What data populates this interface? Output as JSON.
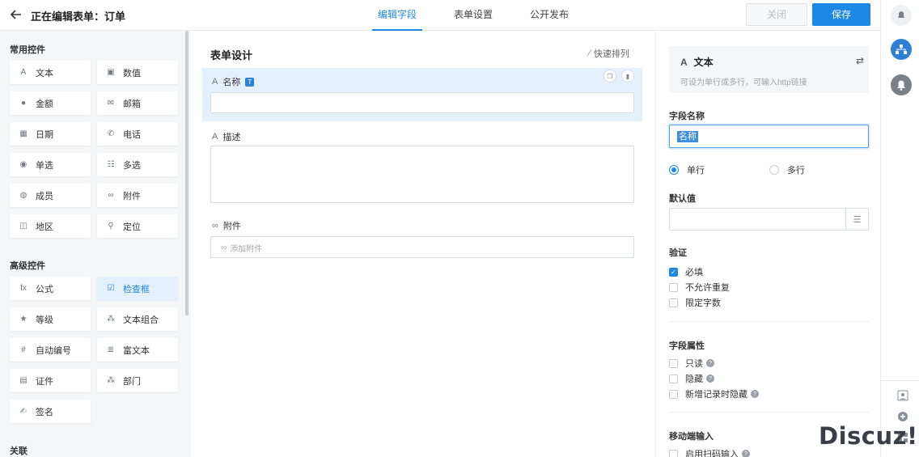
{
  "header": {
    "title_prefix": "正在编辑表单：",
    "title_name": "订单",
    "tabs": [
      {
        "label": "编辑字段",
        "active": true
      },
      {
        "label": "表单设置",
        "active": false
      },
      {
        "label": "公开发布",
        "active": false
      }
    ],
    "close_label": "关闭",
    "save_label": "保存"
  },
  "palette": {
    "groups": [
      {
        "title": "常用控件",
        "items": [
          {
            "label": "文本",
            "icon": "text-a-icon",
            "glyph": "A"
          },
          {
            "label": "数值",
            "icon": "number-icon",
            "glyph": "▣"
          },
          {
            "label": "金额",
            "icon": "money-icon",
            "glyph": "●"
          },
          {
            "label": "邮箱",
            "icon": "mail-icon",
            "glyph": "✉"
          },
          {
            "label": "日期",
            "icon": "calendar-icon",
            "glyph": "▦"
          },
          {
            "label": "电话",
            "icon": "phone-icon",
            "glyph": "✆"
          },
          {
            "label": "单选",
            "icon": "radio-icon",
            "glyph": "◉"
          },
          {
            "label": "多选",
            "icon": "checklist-icon",
            "glyph": "☷"
          },
          {
            "label": "成员",
            "icon": "member-icon",
            "glyph": "◍"
          },
          {
            "label": "附件",
            "icon": "paperclip-icon",
            "glyph": "∞"
          },
          {
            "label": "地区",
            "icon": "map-icon",
            "glyph": "◫"
          },
          {
            "label": "定位",
            "icon": "location-pin-icon",
            "glyph": "⚲"
          }
        ]
      },
      {
        "title": "高级控件",
        "items": [
          {
            "label": "公式",
            "icon": "formula-icon",
            "glyph": "fx"
          },
          {
            "label": "检查框",
            "icon": "checkbox-icon",
            "glyph": "☑",
            "active": true
          },
          {
            "label": "等级",
            "icon": "star-icon",
            "glyph": "★"
          },
          {
            "label": "文本组合",
            "icon": "text-combo-icon",
            "glyph": "⁂"
          },
          {
            "label": "自动编号",
            "icon": "hash-icon",
            "glyph": "#"
          },
          {
            "label": "富文本",
            "icon": "rich-text-icon",
            "glyph": "≣"
          },
          {
            "label": "证件",
            "icon": "id-card-icon",
            "glyph": "▤"
          },
          {
            "label": "部门",
            "icon": "department-icon",
            "glyph": "⁂"
          },
          {
            "label": "签名",
            "icon": "signature-icon",
            "glyph": "✍"
          }
        ]
      },
      {
        "title": "关联",
        "items": []
      }
    ]
  },
  "canvas": {
    "title": "表单设计",
    "quick_sort": "快速排列",
    "fields": [
      {
        "label": "名称",
        "type_badge": "T",
        "selected": true
      },
      {
        "label": "描述"
      },
      {
        "label": "附件",
        "placeholder": "添加附件"
      }
    ]
  },
  "props": {
    "type_title": "文本",
    "type_desc": "可设为单行或多行，可输入http链接",
    "field_name_label": "字段名称",
    "field_name_value": "名称",
    "line_options": [
      {
        "label": "单行",
        "checked": true
      },
      {
        "label": "多行",
        "checked": false
      }
    ],
    "default_label": "默认值",
    "validation_label": "验证",
    "validation_options": [
      {
        "label": "必填",
        "checked": true
      },
      {
        "label": "不允许重复",
        "checked": false
      },
      {
        "label": "限定字数",
        "checked": false
      }
    ],
    "attributes_label": "字段属性",
    "attributes_options": [
      {
        "label": "只读",
        "checked": false,
        "help": true
      },
      {
        "label": "隐藏",
        "checked": false,
        "help": true
      },
      {
        "label": "新增记录时隐藏",
        "checked": false,
        "help": true
      }
    ],
    "mobile_label": "移动端输入",
    "mobile_options": [
      {
        "label": "启用扫码输入",
        "checked": false,
        "help": true
      }
    ]
  },
  "watermark": "Discuz!",
  "colors": {
    "accent": "#1e88e5",
    "selected_bg": "#e4f0fc",
    "panel_bg": "#f5f6f8"
  }
}
